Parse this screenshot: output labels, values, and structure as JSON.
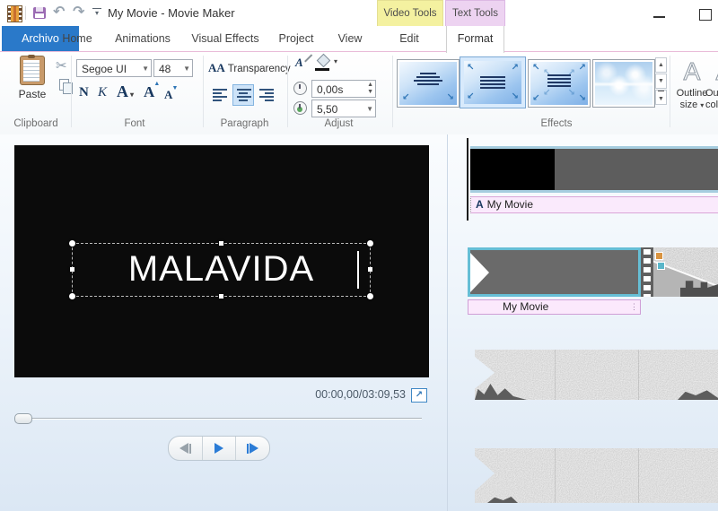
{
  "window": {
    "title": "My Movie - Movie Maker"
  },
  "contextual": {
    "video_tools": "Video Tools",
    "text_tools": "Text Tools"
  },
  "tabs": {
    "archivo": "Archivo",
    "home": "Home",
    "animations": "Animations",
    "visual_effects": "Visual Effects",
    "project": "Project",
    "view": "View",
    "edit": "Edit",
    "format": "Format"
  },
  "ribbon": {
    "clipboard": {
      "group": "Clipboard",
      "paste": "Paste"
    },
    "font": {
      "group": "Font",
      "family": "Segoe UI",
      "size": "48",
      "bold": "N",
      "italic": "K",
      "color": "A",
      "grow": "A",
      "shrink": "A"
    },
    "paragraph": {
      "group": "Paragraph",
      "transparency": "Transparency",
      "transparency_icon": "AA"
    },
    "adjust": {
      "group": "Adjust",
      "edit_icon": "A",
      "start_time": "0,00s",
      "duration": "5,50"
    },
    "effects": {
      "group": "Effects"
    },
    "outline": {
      "size_line1": "Outline",
      "size_line2": "size",
      "color_line1": "Outline",
      "color_line2": "color",
      "a": "A"
    }
  },
  "preview": {
    "title_text": "MALAVIDA",
    "timecode": "00:00,00/03:09,53"
  },
  "timeline": {
    "track1_label": "My Movie",
    "track2_label": "My Movie"
  },
  "colors": {
    "accent_blue": "#2a79c9",
    "video_tools_bg": "#f4f1a0",
    "text_tools_bg": "#edd3f1",
    "selection_teal": "#66bed5",
    "caption_pink": "#faeafc",
    "effect_blue": "#7fb0e6"
  }
}
